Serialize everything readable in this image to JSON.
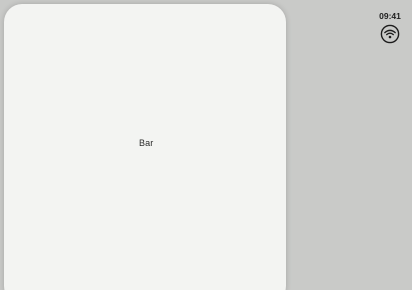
{
  "status_bar": {
    "time": "09:41",
    "icons": [
      "wifi-icon"
    ]
  },
  "card": {
    "label": "Bar"
  },
  "colors": {
    "background": "#c9cac8",
    "card": "#f3f4f2",
    "text": "#2b2b2b"
  }
}
